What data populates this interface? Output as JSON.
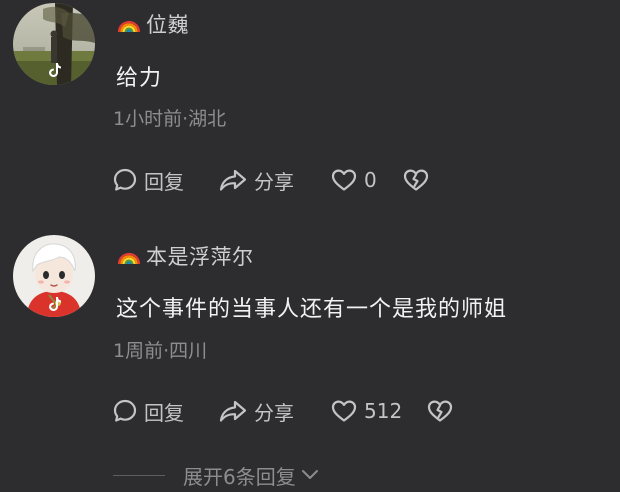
{
  "comments": [
    {
      "username": "位巍",
      "text": "给力",
      "meta": "1小时前·湖北",
      "reply_label": "回复",
      "share_label": "分享",
      "like_count": "0"
    },
    {
      "username": "本是浮萍尔",
      "text": "这个事件的当事人还有一个是我的师姐",
      "meta": "1周前·四川",
      "reply_label": "回复",
      "share_label": "分享",
      "like_count": "512"
    }
  ],
  "expand": {
    "label": "展开6条回复"
  },
  "icons": {
    "badge": "rainbow-flag-icon",
    "reply": "comment-bubble-icon",
    "share": "share-arrow-icon",
    "like": "heart-icon",
    "dislike": "broken-heart-icon",
    "expand": "chevron-down-icon",
    "platform": "tiktok-icon"
  },
  "colors": {
    "background": "#2d2d2f",
    "text_primary": "#f2f2f3",
    "text_secondary": "#8d8d91",
    "action": "#c4c4c7"
  }
}
